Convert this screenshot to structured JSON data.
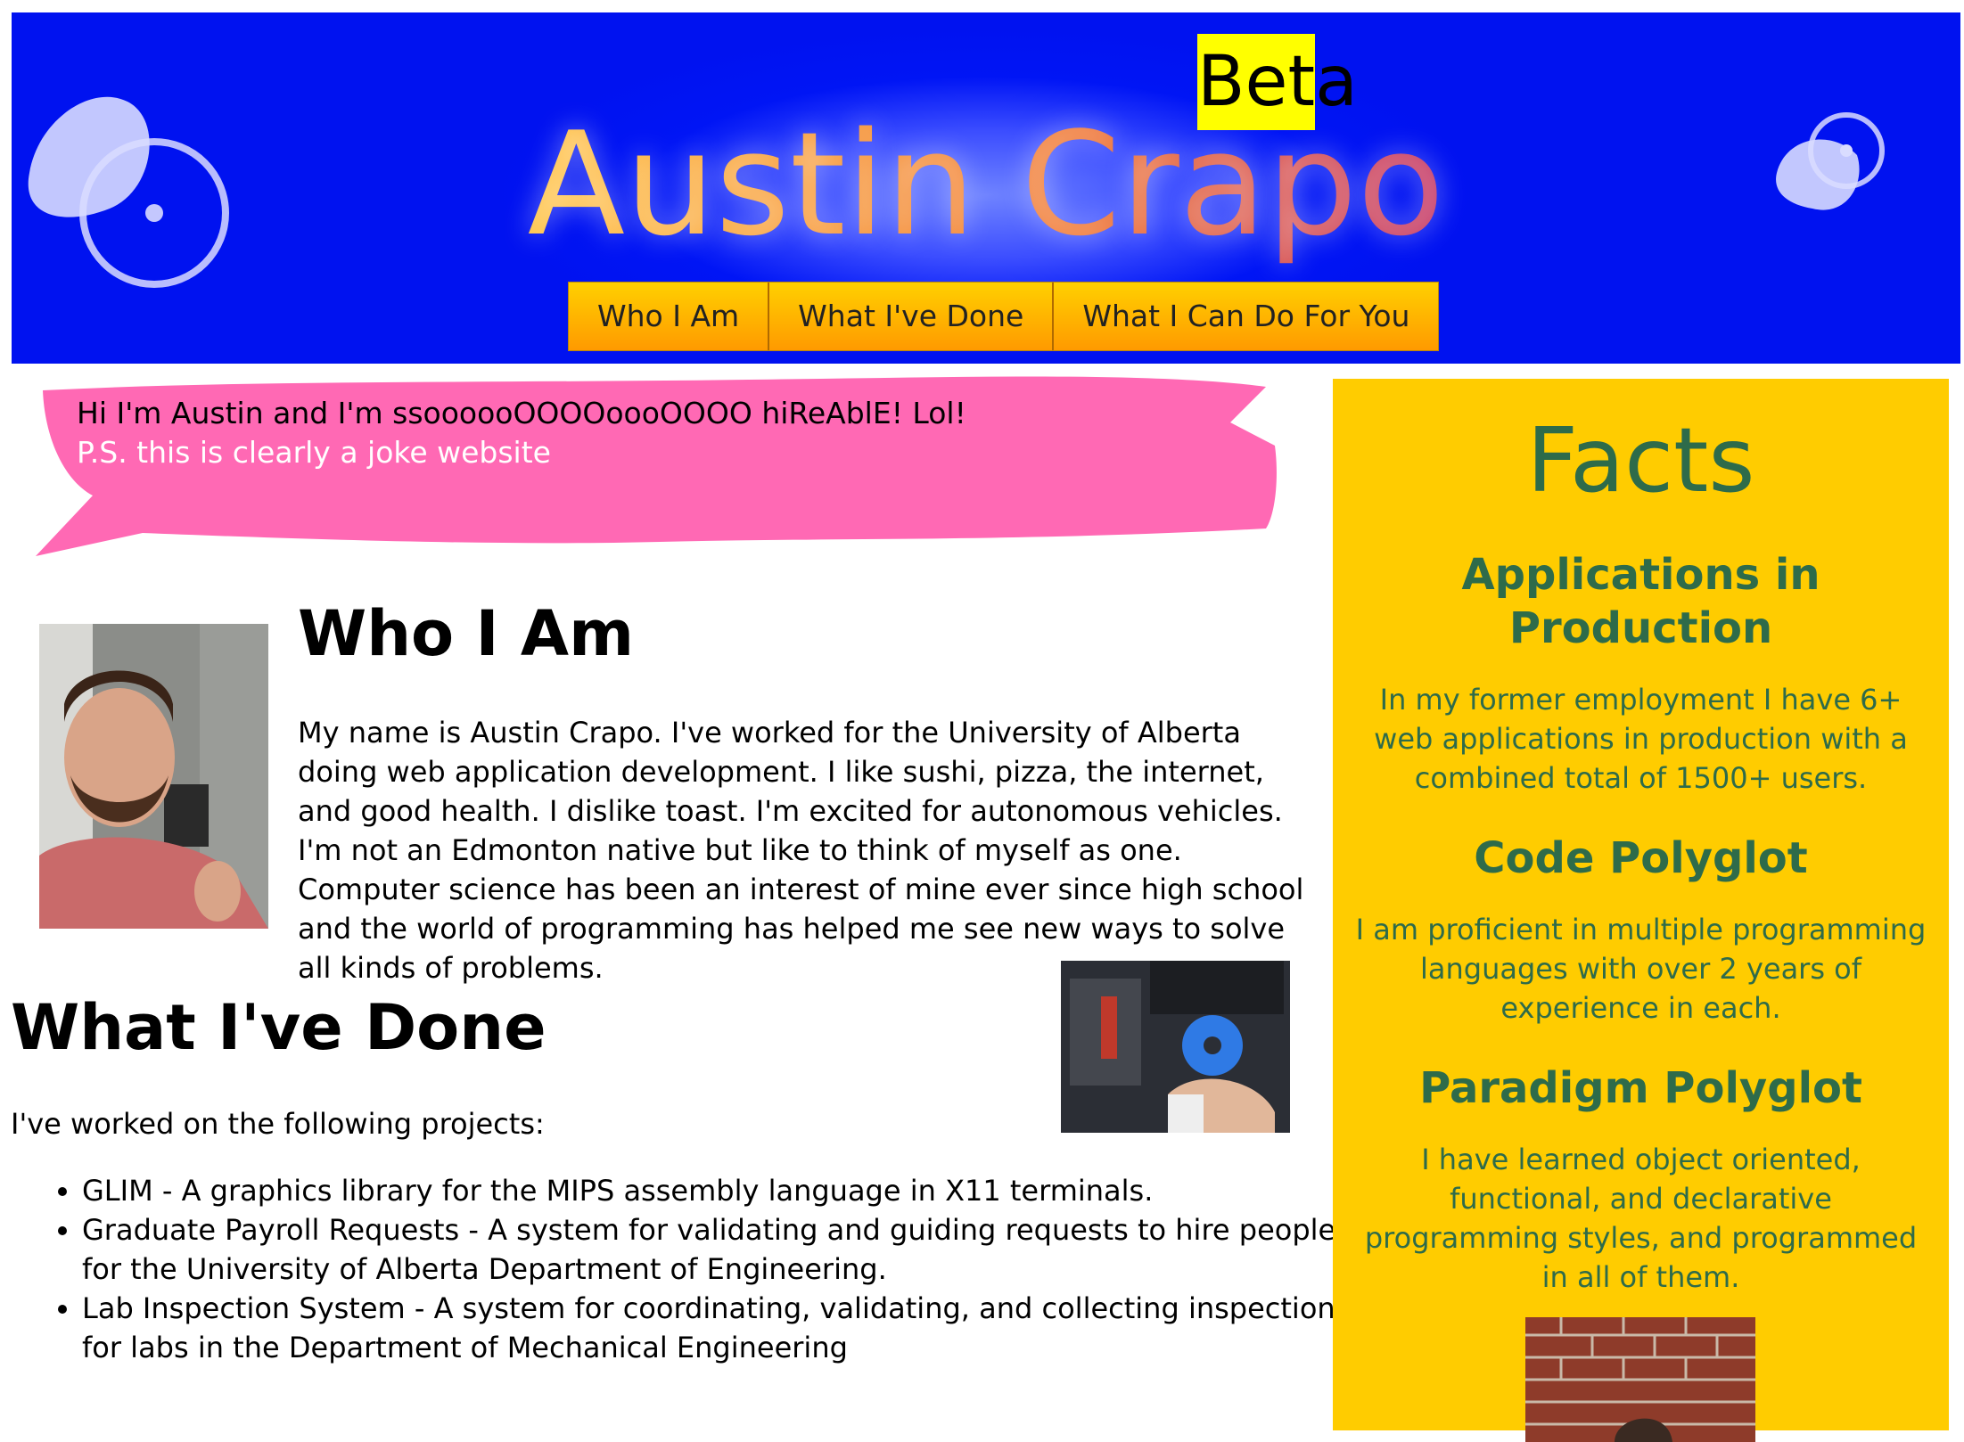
{
  "header": {
    "badge": "Beta",
    "title": "Austin Crapo",
    "nav": [
      {
        "label": "Who I Am"
      },
      {
        "label": "What I've Done"
      },
      {
        "label": "What I Can Do For You"
      }
    ]
  },
  "bubble": {
    "line1": "Hi I'm Austin and I'm ssoooooOOOOoooOOOO hiReAblE! Lol!",
    "line2": "P.S. this is clearly a joke website"
  },
  "who": {
    "heading": "Who I Am",
    "text": "My name is Austin Crapo. I've worked for the University of Alberta doing web application development. I like sushi, pizza, the internet, and good health. I dislike toast. I'm excited for autonomous vehicles. I'm not an Edmonton native but like to think of myself as one. Computer science has been an interest of mine ever since high school and the world of programming has helped me see new ways to solve all kinds of problems."
  },
  "done": {
    "heading": "What I've Done",
    "intro": "I've worked on the following projects:",
    "projects": [
      "GLIM - A graphics library for the MIPS assembly language in X11 terminals.",
      "Graduate Payroll Requests - A system for validating and guiding requests to hire people for the University of Alberta Department of Engineering.",
      "Lab Inspection System - A system for coordinating, validating, and collecting inspections for labs in the Department of Mechanical Engineering"
    ]
  },
  "facts": {
    "title": "Facts",
    "items": [
      {
        "heading": "Applications in Production",
        "text": "In my former employment I have 6+ web applications in production with a combined total of 1500+ users."
      },
      {
        "heading": "Code Polyglot",
        "text": "I am proficient in multiple programming languages with over 2 years of experience in each."
      },
      {
        "heading": "Paradigm Polyglot",
        "text": "I have learned object oriented, functional, and declarative programming styles, and programmed in all of them."
      }
    ]
  },
  "colors": {
    "header_bg": "#0015f5",
    "nav_bg": "#ffa500",
    "bubble": "#ff69b4",
    "facts_bg": "#ffcc00",
    "facts_text": "#2e6b4a",
    "beta_bg": "#ffff00"
  }
}
